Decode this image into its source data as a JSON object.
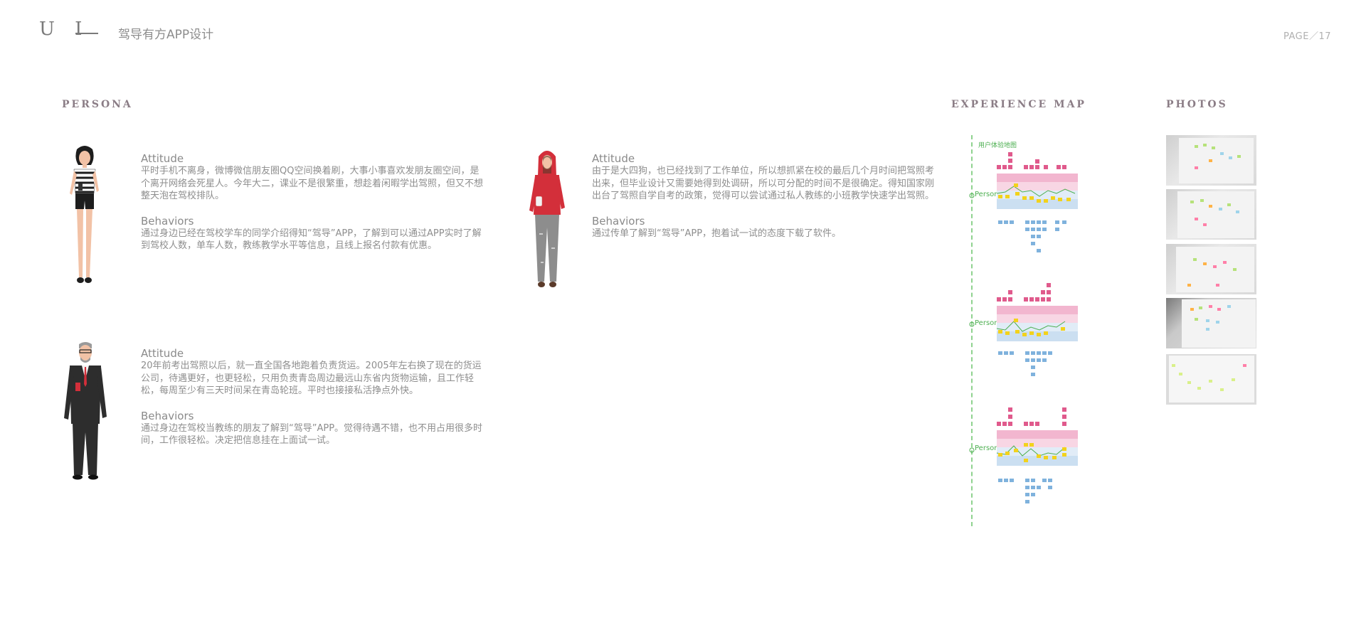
{
  "header": {
    "logo": "U I",
    "app_title": "驾导有方APP设计",
    "page": "PAGE／17"
  },
  "sections": {
    "persona": "PERSONA",
    "experience_map": "EXPERIENCE MAP",
    "photos": "PHOTOS"
  },
  "personas": [
    {
      "attitude_label": "Attitude",
      "attitude": "平时手机不离身，微博微信朋友圈QQ空间换着刷，大事小事喜欢发朋友圈空间，是个离开网络会死星人。今年大二，课业不是很繁重，想趁着闲暇学出驾照，但又不想整天泡在驾校排队。",
      "behaviors_label": "Behaviors",
      "behaviors": "通过身边已经在驾校学车的同学介绍得知“驾导”APP，了解到可以通过APP实时了解到驾校人数，单车人数，教练教学水平等信息，且线上报名付款有优惠。"
    },
    {
      "attitude_label": "Attitude",
      "attitude": "由于是大四狗，也已经找到了工作单位，所以想抓紧在校的最后几个月时间把驾照考出来，但毕业设计又需要她得到处调研，所以可分配的时间不是很确定。得知国家刚出台了驾照自学自考的政策，觉得可以尝试通过私人教练的小班教学快速学出驾照。",
      "behaviors_label": "Behaviors",
      "behaviors": "通过传单了解到“驾导”APP，抱着试一试的态度下载了软件。"
    },
    {
      "attitude_label": "Attitude",
      "attitude": "20年前考出驾照以后，就一直全国各地跑着负责货运。2005年左右换了现在的货运公司，待遇更好，也更轻松，只用负责青岛周边最远山东省内货物运输，且工作轻松，每周至少有三天时间呆在青岛轮班。平时也接接私活挣点外快。",
      "behaviors_label": "Behaviors",
      "behaviors": "通过身边在驾校当教练的朋友了解到“驾导”APP。觉得待遇不错，也不用占用很多时间，工作很轻松。决定把信息挂在上面试一试。"
    }
  ],
  "experience_map": {
    "caption": "用户体验地图",
    "personas": [
      {
        "label": "Persona 1"
      },
      {
        "label": "Persona 2"
      },
      {
        "label": "Persona 3"
      }
    ]
  },
  "colors": {
    "accent_green": "#4caf50",
    "sticky_pink": "#e05a8c",
    "sticky_yellow": "#f2d21c",
    "sticky_blue": "#7fb2dd",
    "section_title": "#8b7d86"
  }
}
